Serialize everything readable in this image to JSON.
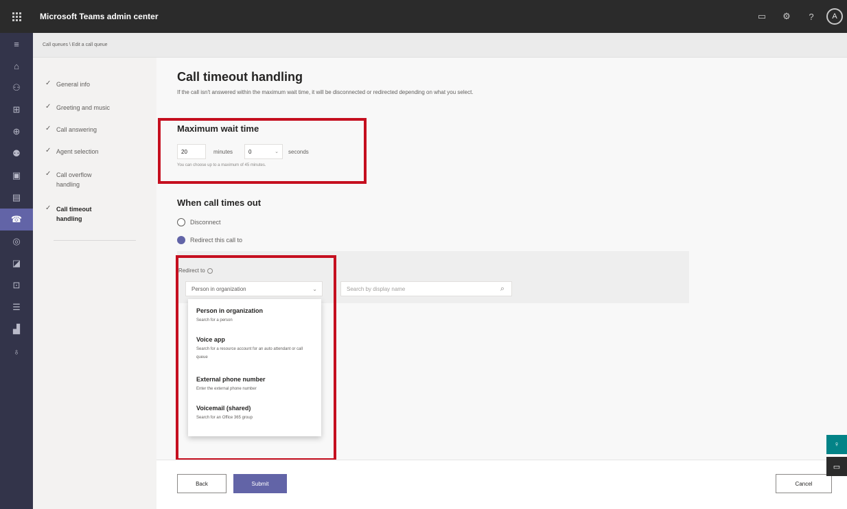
{
  "app": {
    "title": "Microsoft Teams admin center",
    "avatar_initial": "A"
  },
  "topbar": {
    "icons": [
      "screen-icon",
      "gear-icon",
      "help-icon"
    ]
  },
  "breadcrumb": "Call queues \\ Edit a call queue",
  "rail": {
    "icons": [
      "hamburger-icon",
      "home-icon",
      "teams-icon",
      "devices-icon",
      "locations-icon",
      "users-icon",
      "meetings-icon",
      "messaging-icon",
      "voice-icon",
      "policy-icon",
      "apps-icon",
      "external-icon",
      "planning-icon",
      "analytics-icon",
      "notifications-icon"
    ],
    "active_index": 10
  },
  "steps": [
    {
      "label": "General info"
    },
    {
      "label": "Greeting and music"
    },
    {
      "label": "Call answering"
    },
    {
      "label": "Agent selection"
    },
    {
      "label": "Call overflow handling"
    },
    {
      "label": "Call timeout handling"
    }
  ],
  "page": {
    "title": "Call timeout handling",
    "subtitle": "If the call isn't answered within the maximum wait time, it will be disconnected or redirected depending on what you select."
  },
  "max_wait": {
    "heading": "Maximum wait time",
    "minutes_value": "20",
    "minutes_label": "minutes",
    "seconds_value": "0",
    "seconds_label": "seconds",
    "hint": "You can choose up to a maximum of 45 minutes."
  },
  "timeout": {
    "heading": "When call times out",
    "options": [
      "Disconnect",
      "Redirect this call to"
    ],
    "selected_index": 1
  },
  "redirect": {
    "label": "Redirect to",
    "selected": "Person in organization",
    "search_placeholder": "Search by display name",
    "options": [
      {
        "title": "Person in organization",
        "desc": "Search for a person"
      },
      {
        "title": "Voice app",
        "desc": "Search for a resource account for an auto attendant or call queue"
      },
      {
        "title": "External phone number",
        "desc": "Enter the external phone number"
      },
      {
        "title": "Voicemail (shared)",
        "desc": "Search for an Office 365 group"
      }
    ]
  },
  "footer": {
    "back": "Back",
    "submit": "Submit",
    "cancel": "Cancel"
  },
  "colors": {
    "accent": "#6264a7",
    "highlight": "#c50f1f",
    "rail": "#33344a",
    "topbar": "#2b2b2b"
  }
}
